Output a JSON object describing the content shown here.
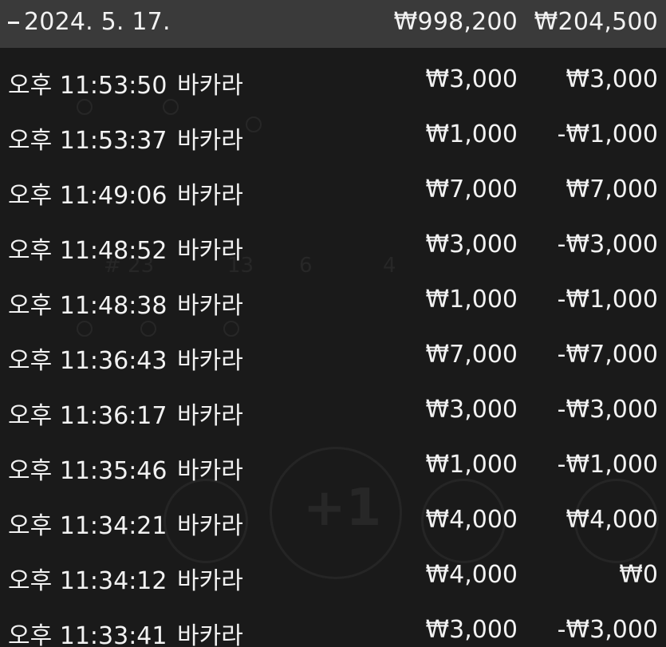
{
  "header": {
    "collapse_icon": "minus-icon",
    "date": "2024. 5. 17.",
    "total_bet": "₩998,200",
    "total_profit": "₩204,500"
  },
  "rows": [
    {
      "time": "오후 11:53:50",
      "game": "바카라",
      "bet": "₩3,000",
      "profit": "₩3,000"
    },
    {
      "time": "오후 11:53:37",
      "game": "바카라",
      "bet": "₩1,000",
      "profit": "-₩1,000"
    },
    {
      "time": "오후 11:49:06",
      "game": "바카라",
      "bet": "₩7,000",
      "profit": "₩7,000"
    },
    {
      "time": "오후 11:48:52",
      "game": "바카라",
      "bet": "₩3,000",
      "profit": "-₩3,000"
    },
    {
      "time": "오후 11:48:38",
      "game": "바카라",
      "bet": "₩1,000",
      "profit": "-₩1,000"
    },
    {
      "time": "오후 11:36:43",
      "game": "바카라",
      "bet": "₩7,000",
      "profit": "-₩7,000"
    },
    {
      "time": "오후 11:36:17",
      "game": "바카라",
      "bet": "₩3,000",
      "profit": "-₩3,000"
    },
    {
      "time": "오후 11:35:46",
      "game": "바카라",
      "bet": "₩1,000",
      "profit": "-₩1,000"
    },
    {
      "time": "오후 11:34:21",
      "game": "바카라",
      "bet": "₩4,000",
      "profit": "₩4,000"
    },
    {
      "time": "오후 11:34:12",
      "game": "바카라",
      "bet": "₩4,000",
      "profit": "₩0"
    },
    {
      "time": "오후 11:33:41",
      "game": "바카라",
      "bet": "₩3,000",
      "profit": "-₩3,000"
    }
  ],
  "colors": {
    "background": "#1a1a1a",
    "header_background": "#3a3a3a",
    "text": "#f2f2f2"
  }
}
